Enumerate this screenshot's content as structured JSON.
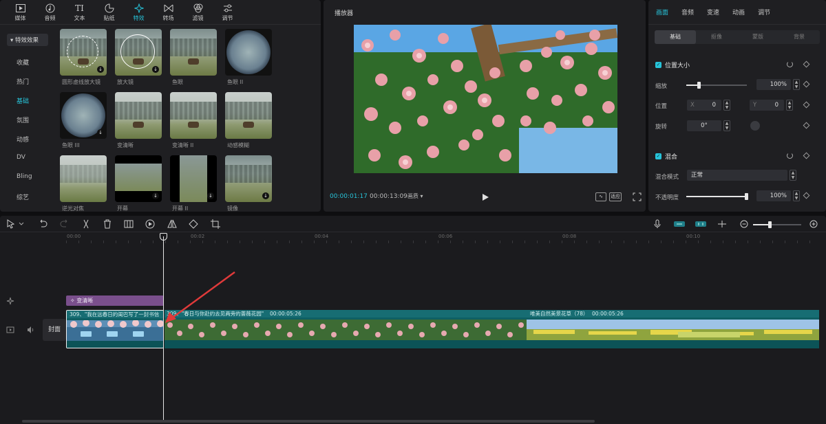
{
  "toolbar": {
    "tabs": [
      {
        "label": "媒体",
        "icon": "media-icon"
      },
      {
        "label": "音频",
        "icon": "audio-icon"
      },
      {
        "label": "文本",
        "icon": "text-icon"
      },
      {
        "label": "贴纸",
        "icon": "sticker-icon"
      },
      {
        "label": "特效",
        "icon": "effects-icon",
        "active": true
      },
      {
        "label": "转场",
        "icon": "transition-icon"
      },
      {
        "label": "滤镜",
        "icon": "filter-icon"
      },
      {
        "label": "调节",
        "icon": "adjust-icon"
      }
    ]
  },
  "effects_sidebar": {
    "header": "▾ 特效效果",
    "items": [
      "收藏",
      "热门",
      "基础",
      "氛围",
      "动感",
      "DV",
      "Bling",
      "综艺"
    ],
    "active_index": 2
  },
  "effects": [
    "圆形虚线放大镜",
    "放大镜",
    "鱼眼",
    "鱼眼 II",
    "鱼眼 III",
    "变清晰",
    "变清晰 II",
    "动感模糊",
    "逆光对焦",
    "开幕",
    "开幕 II",
    "镜像"
  ],
  "player": {
    "title": "播放器",
    "current_time": "00:00:01:17",
    "total_time": "00:00:13:09",
    "quality": "画质",
    "ratio_button": "适应"
  },
  "properties": {
    "tabs": [
      "画面",
      "音频",
      "变速",
      "动画",
      "调节"
    ],
    "active_tab": 0,
    "subtabs": [
      "基础",
      "抠像",
      "蒙版",
      "背景"
    ],
    "active_subtab": 0,
    "position_size": {
      "title": "位置大小",
      "scale_label": "缩放",
      "scale_value": "100%",
      "scale_fraction": 0.2,
      "position_label": "位置",
      "x_label": "X",
      "x_value": "0",
      "y_label": "Y",
      "y_value": "0",
      "rotate_label": "旋转",
      "rotate_value": "0°"
    },
    "blend": {
      "title": "混合",
      "mode_label": "混合模式",
      "mode_value": "正常",
      "opacity_label": "不透明度",
      "opacity_value": "100%",
      "opacity_fraction": 1.0
    }
  },
  "timeline": {
    "ruler": [
      "00:00",
      "00:02",
      "00:04",
      "00:06",
      "00:08",
      "00:10"
    ],
    "effect_clip": "变清晰",
    "cover_label": "封面",
    "clips": [
      {
        "title": "309、\"我在远春日的闺巴写了一封书信",
        "duration": ""
      },
      {
        "title": "309、\"春日与你赴约去见两旁的蔷薇花园\"",
        "duration": "00:00:05:26"
      },
      {
        "title": "唯美自然美景花草（78）",
        "duration": "00:00:05:26"
      }
    ]
  }
}
